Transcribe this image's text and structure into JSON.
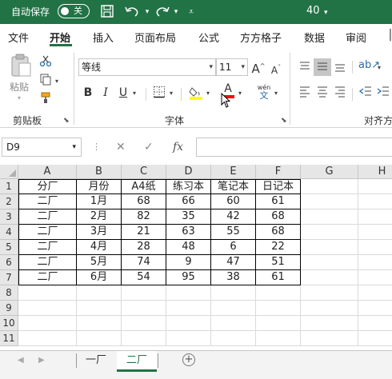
{
  "titlebar": {
    "autosave_label": "自动保存",
    "toggle_state": "关",
    "doc_title": "40",
    "icons": [
      "save-icon",
      "undo-icon",
      "redo-icon",
      "customize-qat-icon"
    ]
  },
  "ribbon_tabs": [
    {
      "label": "文件",
      "active": false
    },
    {
      "label": "开始",
      "active": true
    },
    {
      "label": "插入",
      "active": false
    },
    {
      "label": "页面布局",
      "active": false
    },
    {
      "label": "公式",
      "active": false
    },
    {
      "label": "方方格子",
      "active": false
    },
    {
      "label": "数据",
      "active": false
    },
    {
      "label": "审阅",
      "active": false
    }
  ],
  "ribbon": {
    "paste_label": "粘贴",
    "clipboard_label": "剪贴板",
    "font_label": "字体",
    "alignment_label": "对齐方",
    "font_name": "等线",
    "font_size": "11",
    "bold": "B",
    "italic": "I",
    "underline": "U",
    "grow_font": "A",
    "shrink_font": "A",
    "font_color_letter": "A",
    "phonetic_top": "wén",
    "phonetic_bottom": "文",
    "fill_color": "#ffff00",
    "font_color": "#ff0000",
    "accent": "#217346"
  },
  "formula_bar": {
    "name_box": "D9",
    "cancel_icon": "✕",
    "enter_icon": "✓",
    "fx_label": "fx",
    "formula": ""
  },
  "columns": [
    "A",
    "B",
    "C",
    "D",
    "E",
    "F",
    "G",
    "H"
  ],
  "rows": [
    "1",
    "2",
    "3",
    "4",
    "5",
    "6",
    "7",
    "8",
    "9",
    "10",
    "11"
  ],
  "table": {
    "headers": [
      "分厂",
      "月份",
      "A4纸",
      "练习本",
      "笔记本",
      "日记本"
    ],
    "rows": [
      [
        "二厂",
        "1月",
        "68",
        "66",
        "60",
        "61"
      ],
      [
        "二厂",
        "2月",
        "82",
        "35",
        "42",
        "68"
      ],
      [
        "二厂",
        "3月",
        "21",
        "63",
        "55",
        "68"
      ],
      [
        "二厂",
        "4月",
        "28",
        "48",
        "6",
        "22"
      ],
      [
        "二厂",
        "5月",
        "74",
        "9",
        "47",
        "51"
      ],
      [
        "二厂",
        "6月",
        "54",
        "95",
        "38",
        "61"
      ]
    ]
  },
  "sheets": [
    {
      "label": "一厂",
      "active": false
    },
    {
      "label": "二厂",
      "active": true
    }
  ],
  "add_sheet": "+"
}
